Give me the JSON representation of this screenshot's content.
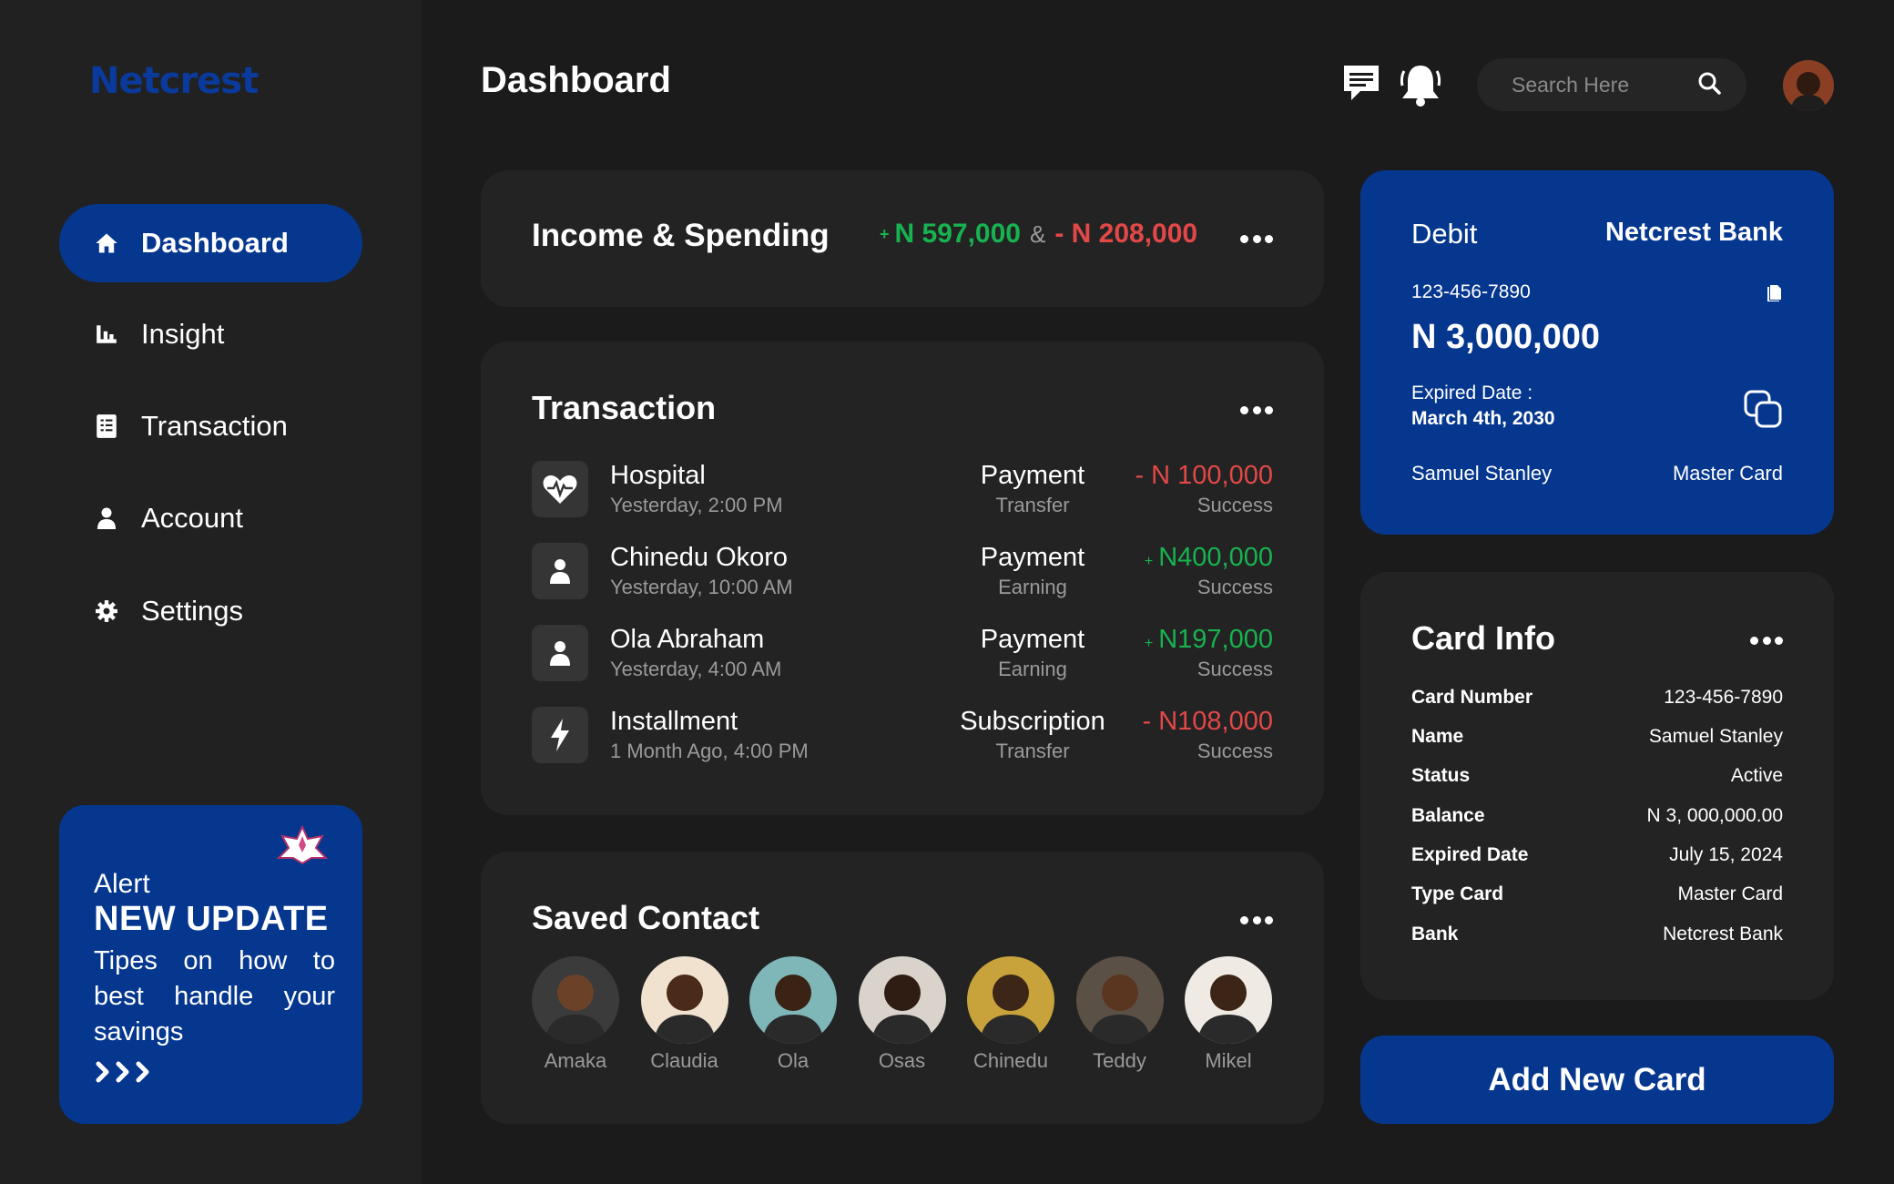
{
  "brand": {
    "logo": "Netcrest"
  },
  "sidebar": {
    "items": [
      {
        "label": "Dashboard",
        "icon": "home-icon",
        "active": true
      },
      {
        "label": "Insight",
        "icon": "bar-chart-icon"
      },
      {
        "label": "Transaction",
        "icon": "receipt-icon"
      },
      {
        "label": "Account",
        "icon": "person-icon"
      },
      {
        "label": "Settings",
        "icon": "gear-icon"
      }
    ],
    "alert": {
      "label": "Alert",
      "title": "NEW UPDATE",
      "text": "Tipes on how to best handle your savings",
      "arrows": "›››"
    }
  },
  "header": {
    "title": "Dashboard",
    "search_placeholder": "Search Here"
  },
  "income": {
    "title": "Income & Spending",
    "income_sign": "+",
    "income_value": "N 597,000",
    "amp": "&",
    "spending_value": "- N 208,000"
  },
  "transaction": {
    "title": "Transaction",
    "rows": [
      {
        "name": "Hospital",
        "time": "Yesterday, 2:00 PM",
        "type": "Payment",
        "sub": "Transfer",
        "sign": "",
        "amount": "- N 100,000",
        "status": "Success",
        "icon": "heart-pulse-icon"
      },
      {
        "name": "Chinedu Okoro",
        "time": "Yesterday, 10:00 AM",
        "type": "Payment",
        "sub": "Earning",
        "sign": "+",
        "amount": "N400,000",
        "status": "Success",
        "icon": "person-icon"
      },
      {
        "name": "Ola Abraham",
        "time": "Yesterday, 4:00 AM",
        "type": "Payment",
        "sub": "Earning",
        "sign": "+",
        "amount": "N197,000",
        "status": "Success",
        "icon": "person-icon"
      },
      {
        "name": "Installment",
        "time": "1 Month Ago, 4:00 PM",
        "type": "Subscription",
        "sub": "Transfer",
        "sign": "",
        "amount": "- N108,000",
        "status": "Success",
        "icon": "lightning-icon"
      }
    ]
  },
  "contacts": {
    "title": "Saved Contact",
    "people": [
      {
        "name": "Amaka",
        "bg": "#3b3b3b",
        "skin": "#6b4228"
      },
      {
        "name": "Claudia",
        "bg": "#f1e2d0",
        "skin": "#4a2a18"
      },
      {
        "name": "Ola",
        "bg": "#7fb6b8",
        "skin": "#3a2214"
      },
      {
        "name": "Osas",
        "bg": "#d9d3cc",
        "skin": "#2f1d13"
      },
      {
        "name": "Chinedu",
        "bg": "#c8a23a",
        "skin": "#3b2617"
      },
      {
        "name": "Teddy",
        "bg": "#5b5045",
        "skin": "#5a3520"
      },
      {
        "name": "Mikel",
        "bg": "#efeae4",
        "skin": "#3c2416"
      }
    ]
  },
  "debit_card": {
    "label": "Debit",
    "bank": "Netcrest Bank",
    "number": "123-456-7890",
    "balance": "N 3,000,000",
    "expired_label": "Expired Date :",
    "expired": "March 4th, 2030",
    "holder": "Samuel Stanley",
    "type": "Master Card"
  },
  "card_info": {
    "title": "Card Info",
    "rows": [
      {
        "key": "Card Number",
        "value": "123-456-7890"
      },
      {
        "key": "Name",
        "value": "Samuel Stanley"
      },
      {
        "key": "Status",
        "value": "Active"
      },
      {
        "key": "Balance",
        "value": "N 3, 000,000.00"
      },
      {
        "key": "Expired Date",
        "value": "July 15, 2024"
      },
      {
        "key": "Type Card",
        "value": "Master Card"
      },
      {
        "key": "Bank",
        "value": "Netcrest Bank"
      }
    ]
  },
  "add_card_label": "Add New Card",
  "colors": {
    "background": "#1b1b1b",
    "sidebar": "#212121",
    "panel": "#232323",
    "accent": "#05378f",
    "income": "#17b350",
    "spending": "#e34848"
  }
}
